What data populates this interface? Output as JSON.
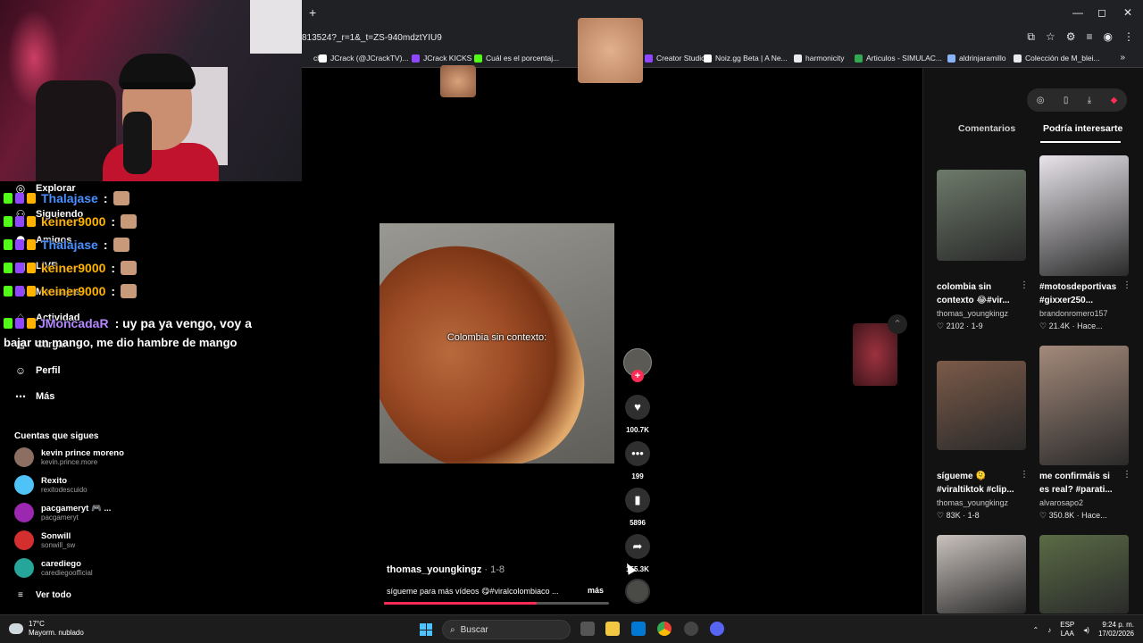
{
  "browser": {
    "new_tab": "+",
    "url": "813524?_r=1&_t=ZS-940mdztYIU9",
    "bookmarks": [
      {
        "label": "ch",
        "color": "#202124"
      },
      {
        "label": "JCrack (@JCrackTV)...",
        "color": "#ffffff"
      },
      {
        "label": "JCrack KICKS",
        "color": "#9146ff"
      },
      {
        "label": "Cuál es el porcentaj...",
        "color": "#53fc18"
      },
      {
        "label": "Creator Studio",
        "color": "#9146ff"
      },
      {
        "label": "Noiz.gg Beta | A Ne...",
        "color": "#ffffff"
      },
      {
        "label": "harmonicity",
        "color": "#e8eaed"
      },
      {
        "label": "Articulos - SIMULAC...",
        "color": "#34a853"
      },
      {
        "label": "aldrinjaramillo",
        "color": "#8ab4f8"
      },
      {
        "label": "Colección de M_blei...",
        "color": "#e8eaed"
      }
    ],
    "more_bookmarks": "»"
  },
  "sidebar": {
    "nav": [
      {
        "label": "Explorar",
        "icon": "compass-icon",
        "glyph": "◎"
      },
      {
        "label": "Siguiendo",
        "icon": "following-icon",
        "glyph": "⚇"
      },
      {
        "label": "Amigos",
        "icon": "friends-icon",
        "glyph": "⚉"
      },
      {
        "label": "LIVE",
        "icon": "live-icon",
        "glyph": "▣"
      },
      {
        "label": "Mensajes",
        "icon": "messages-icon",
        "glyph": "✉"
      },
      {
        "label": "Actividad",
        "icon": "activity-icon",
        "glyph": "♢"
      },
      {
        "label": "Cargar",
        "icon": "upload-icon",
        "glyph": "⊞"
      },
      {
        "label": "Perfil",
        "icon": "profile-icon",
        "glyph": "☺"
      },
      {
        "label": "Más",
        "icon": "more-icon",
        "glyph": "⋯"
      }
    ],
    "following_title": "Cuentas que sigues",
    "following": [
      {
        "name": "kevin prince moreno",
        "handle": "kevin.prince.more",
        "color": "#8d6e63"
      },
      {
        "name": "Rexito",
        "handle": "rexitodescuido",
        "color": "#4fc3f7"
      },
      {
        "name": "pacgameryt 🎮 ...",
        "handle": "pacgameryt",
        "color": "#9c27b0"
      },
      {
        "name": "Sonwill",
        "handle": "sonwill_sw",
        "color": "#d32f2f"
      },
      {
        "name": "carediego",
        "handle": "carediegoofficial",
        "color": "#26a69a"
      }
    ],
    "see_all": "Ver todo"
  },
  "chat": {
    "lines": [
      {
        "user": "Thalajase",
        "color": "#4a8fff"
      },
      {
        "user": "keiner9000",
        "color": "#ffb300"
      },
      {
        "user": "Thalajase",
        "color": "#4a8fff"
      },
      {
        "user": "keiner9000",
        "color": "#ffb300"
      },
      {
        "user": "keiner9000",
        "color": "#ffb300"
      }
    ],
    "colon": ":",
    "last_user": "JMoncadaR",
    "last_user_color": "#b388ff",
    "last_msg_part1": ": uy pa ya vengo, voy a",
    "last_msg_part2": "bajar un mango, me dio hambre de mango"
  },
  "video": {
    "caption": "Colombia sin contexto:",
    "likes": "100.7K",
    "comments": "199",
    "saves": "5896",
    "shares": "155.3K",
    "author": "thomas_youngkingz",
    "date": " · 1-8",
    "description": "sígueme para más vídeos 😋#viralcolombiaco ...",
    "more": "más",
    "progress": 0.68,
    "accent": "#fe2c55"
  },
  "panel": {
    "tabs": {
      "comments": "Comentarios",
      "interest": "Podría interesarte"
    },
    "cards": [
      {
        "title_l1": "colombia sin",
        "title_l2": "contexto 😂#vir...",
        "user": "thomas_youngkingz",
        "stats": "♡ 2102 · 1-9",
        "thumb": "#6d7a6a"
      },
      {
        "title_l1": "#motosdeportivas",
        "title_l2": "#gixxer250...",
        "user": "brandonromero157",
        "stats": "♡ 21.4K · Hace...",
        "thumb": "#e8e4ea"
      },
      {
        "title_l1": "sígueme 🫠",
        "title_l2": "#viraltiktok #clip...",
        "user": "thomas_youngkingz",
        "stats": "♡ 83K · 1-8",
        "thumb": "#7b5a48"
      },
      {
        "title_l1": "me confirmáis si",
        "title_l2": "es real? #parati...",
        "user": "alvarosapo2",
        "stats": "♡ 350.8K · Hace...",
        "thumb": "#a3897a"
      },
      {
        "title_l1": "",
        "title_l2": "",
        "user": "",
        "stats": "",
        "thumb": "#c9c2bd"
      },
      {
        "title_l1": "",
        "title_l2": "",
        "user": "",
        "stats": "",
        "thumb": "#5a6b45"
      }
    ]
  },
  "taskbar": {
    "temp": "17°C",
    "weather": "Mayorm. nublado",
    "search": "Buscar",
    "lang1": "ESP",
    "lang2": "LAA",
    "time": "9:24 p. m.",
    "date": "17/02/2026"
  }
}
